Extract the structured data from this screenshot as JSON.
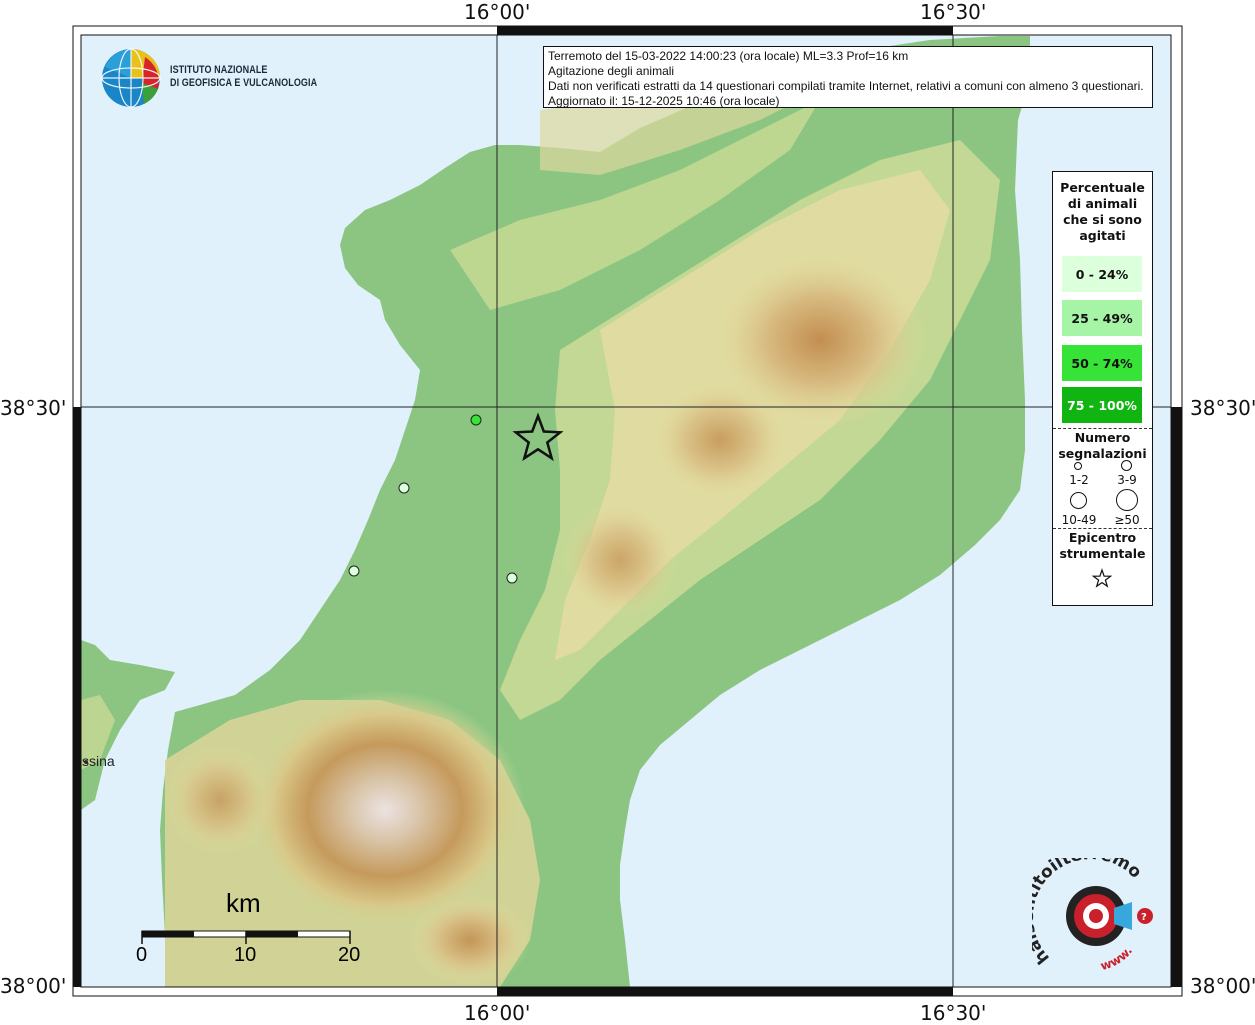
{
  "info": {
    "line1": "Terremoto del 15-03-2022 14:00:23 (ora locale) ML=3.3 Prof=16 km",
    "line2": "Agitazione degli animali",
    "line3": "Dati non verificati estratti da 14 questionari compilati tramite Internet, relativi a comuni con almeno 3 questionari.",
    "line4": "Aggiornato il: 15-12-2025 10:46 (ora locale)"
  },
  "axes": {
    "lon_left": "16°00'",
    "lon_right": "16°30'",
    "lat_mid": "38°30'",
    "lat_bottom": "38°00'"
  },
  "logo": {
    "line1": "ISTITUTO NAZIONALE",
    "line2": "DI GEOFISICA E VULCANOLOGIA"
  },
  "legend": {
    "title_lines": [
      "Percentuale",
      "di animali",
      "che si sono",
      "agitati"
    ],
    "categories": [
      {
        "label": "0 - 24%",
        "color": "#dcffdc",
        "text_color": "#111"
      },
      {
        "label": "25 - 49%",
        "color": "#a6f5a6",
        "text_color": "#111"
      },
      {
        "label": "50 - 74%",
        "color": "#36e336",
        "text_color": "#111"
      },
      {
        "label": "75 - 100%",
        "color": "#11b511",
        "text_color": "#ffffff"
      }
    ],
    "count_title": [
      "Numero",
      "segnalazioni"
    ],
    "sizes": [
      "1-2",
      "3-9",
      "10-49",
      "≥50"
    ],
    "epicenter_title": [
      "Epicentro",
      "strumentale"
    ]
  },
  "scale": {
    "unit": "km",
    "ticks": [
      "0",
      "10",
      "20"
    ]
  },
  "town": "ssina",
  "brand": {
    "text": "haisentitoilterremoto.it",
    "url": "www."
  },
  "colors": {
    "sea": "#e0f1fb",
    "land_low": "#8fc784",
    "land_mid": "#e6e1a2",
    "land_high": "#c49554",
    "peak": "#e9dcdc"
  }
}
